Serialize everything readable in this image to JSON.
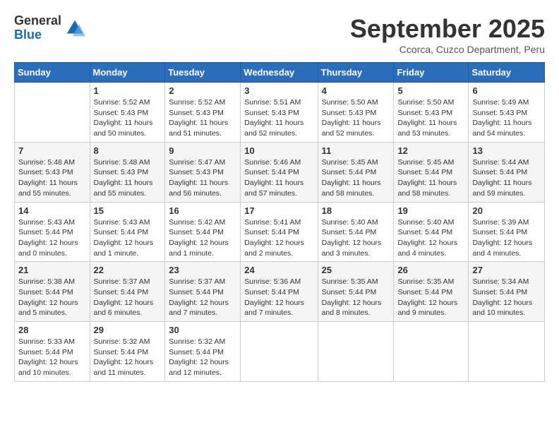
{
  "logo": {
    "general": "General",
    "blue": "Blue"
  },
  "title": "September 2025",
  "location": "Ccorca, Cuzco Department, Peru",
  "days_of_week": [
    "Sunday",
    "Monday",
    "Tuesday",
    "Wednesday",
    "Thursday",
    "Friday",
    "Saturday"
  ],
  "weeks": [
    [
      {
        "day": null
      },
      {
        "day": 1,
        "sunrise": "5:52 AM",
        "sunset": "5:43 PM",
        "daylight": "11 hours and 50 minutes."
      },
      {
        "day": 2,
        "sunrise": "5:52 AM",
        "sunset": "5:43 PM",
        "daylight": "11 hours and 51 minutes."
      },
      {
        "day": 3,
        "sunrise": "5:51 AM",
        "sunset": "5:43 PM",
        "daylight": "11 hours and 52 minutes."
      },
      {
        "day": 4,
        "sunrise": "5:50 AM",
        "sunset": "5:43 PM",
        "daylight": "11 hours and 52 minutes."
      },
      {
        "day": 5,
        "sunrise": "5:50 AM",
        "sunset": "5:43 PM",
        "daylight": "11 hours and 53 minutes."
      },
      {
        "day": 6,
        "sunrise": "5:49 AM",
        "sunset": "5:43 PM",
        "daylight": "11 hours and 54 minutes."
      }
    ],
    [
      {
        "day": 7,
        "sunrise": "5:48 AM",
        "sunset": "5:43 PM",
        "daylight": "11 hours and 55 minutes."
      },
      {
        "day": 8,
        "sunrise": "5:48 AM",
        "sunset": "5:43 PM",
        "daylight": "11 hours and 55 minutes."
      },
      {
        "day": 9,
        "sunrise": "5:47 AM",
        "sunset": "5:43 PM",
        "daylight": "11 hours and 56 minutes."
      },
      {
        "day": 10,
        "sunrise": "5:46 AM",
        "sunset": "5:44 PM",
        "daylight": "11 hours and 57 minutes."
      },
      {
        "day": 11,
        "sunrise": "5:45 AM",
        "sunset": "5:44 PM",
        "daylight": "11 hours and 58 minutes."
      },
      {
        "day": 12,
        "sunrise": "5:45 AM",
        "sunset": "5:44 PM",
        "daylight": "11 hours and 58 minutes."
      },
      {
        "day": 13,
        "sunrise": "5:44 AM",
        "sunset": "5:44 PM",
        "daylight": "11 hours and 59 minutes."
      }
    ],
    [
      {
        "day": 14,
        "sunrise": "5:43 AM",
        "sunset": "5:44 PM",
        "daylight": "12 hours and 0 minutes."
      },
      {
        "day": 15,
        "sunrise": "5:43 AM",
        "sunset": "5:44 PM",
        "daylight": "12 hours and 1 minute."
      },
      {
        "day": 16,
        "sunrise": "5:42 AM",
        "sunset": "5:44 PM",
        "daylight": "12 hours and 1 minute."
      },
      {
        "day": 17,
        "sunrise": "5:41 AM",
        "sunset": "5:44 PM",
        "daylight": "12 hours and 2 minutes."
      },
      {
        "day": 18,
        "sunrise": "5:40 AM",
        "sunset": "5:44 PM",
        "daylight": "12 hours and 3 minutes."
      },
      {
        "day": 19,
        "sunrise": "5:40 AM",
        "sunset": "5:44 PM",
        "daylight": "12 hours and 4 minutes."
      },
      {
        "day": 20,
        "sunrise": "5:39 AM",
        "sunset": "5:44 PM",
        "daylight": "12 hours and 4 minutes."
      }
    ],
    [
      {
        "day": 21,
        "sunrise": "5:38 AM",
        "sunset": "5:44 PM",
        "daylight": "12 hours and 5 minutes."
      },
      {
        "day": 22,
        "sunrise": "5:37 AM",
        "sunset": "5:44 PM",
        "daylight": "12 hours and 6 minutes."
      },
      {
        "day": 23,
        "sunrise": "5:37 AM",
        "sunset": "5:44 PM",
        "daylight": "12 hours and 7 minutes."
      },
      {
        "day": 24,
        "sunrise": "5:36 AM",
        "sunset": "5:44 PM",
        "daylight": "12 hours and 7 minutes."
      },
      {
        "day": 25,
        "sunrise": "5:35 AM",
        "sunset": "5:44 PM",
        "daylight": "12 hours and 8 minutes."
      },
      {
        "day": 26,
        "sunrise": "5:35 AM",
        "sunset": "5:44 PM",
        "daylight": "12 hours and 9 minutes."
      },
      {
        "day": 27,
        "sunrise": "5:34 AM",
        "sunset": "5:44 PM",
        "daylight": "12 hours and 10 minutes."
      }
    ],
    [
      {
        "day": 28,
        "sunrise": "5:33 AM",
        "sunset": "5:44 PM",
        "daylight": "12 hours and 10 minutes."
      },
      {
        "day": 29,
        "sunrise": "5:32 AM",
        "sunset": "5:44 PM",
        "daylight": "12 hours and 11 minutes."
      },
      {
        "day": 30,
        "sunrise": "5:32 AM",
        "sunset": "5:44 PM",
        "daylight": "12 hours and 12 minutes."
      },
      {
        "day": null
      },
      {
        "day": null
      },
      {
        "day": null
      },
      {
        "day": null
      }
    ]
  ]
}
